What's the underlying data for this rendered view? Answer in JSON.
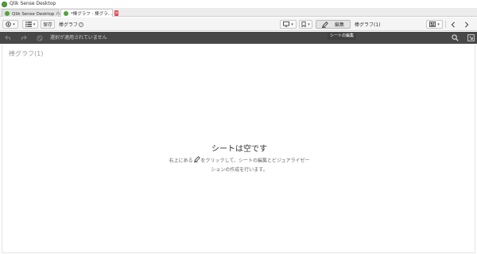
{
  "window": {
    "title": "Qlik Sense Desktop"
  },
  "tabs": [
    {
      "label": "Qlik Sense Desktop ハブ",
      "active": false
    },
    {
      "label": "*棒グラフ - 棒グラ…",
      "active": true,
      "close": "×"
    }
  ],
  "toolbar": {
    "save_label": "保存",
    "app_title": "棒グラフ",
    "help_glyph": "?",
    "edit_label": "編集",
    "sheet_name": "棒グラフ(1)",
    "caret": "▾"
  },
  "tooltip": {
    "text": "シートの編集"
  },
  "selections": {
    "status_text": "選択が適用されていません"
  },
  "sheet": {
    "title": "棒グラフ(1)",
    "empty_title": "シートは空です",
    "empty_msg_before": "右上にある",
    "empty_msg_after": "をクリックして、シートの編集とビジュアライゼーションの作成を行います。"
  },
  "colors": {
    "accent_green": "#52a33a",
    "close_red": "#e8424c",
    "selection_bar": "#484848"
  }
}
